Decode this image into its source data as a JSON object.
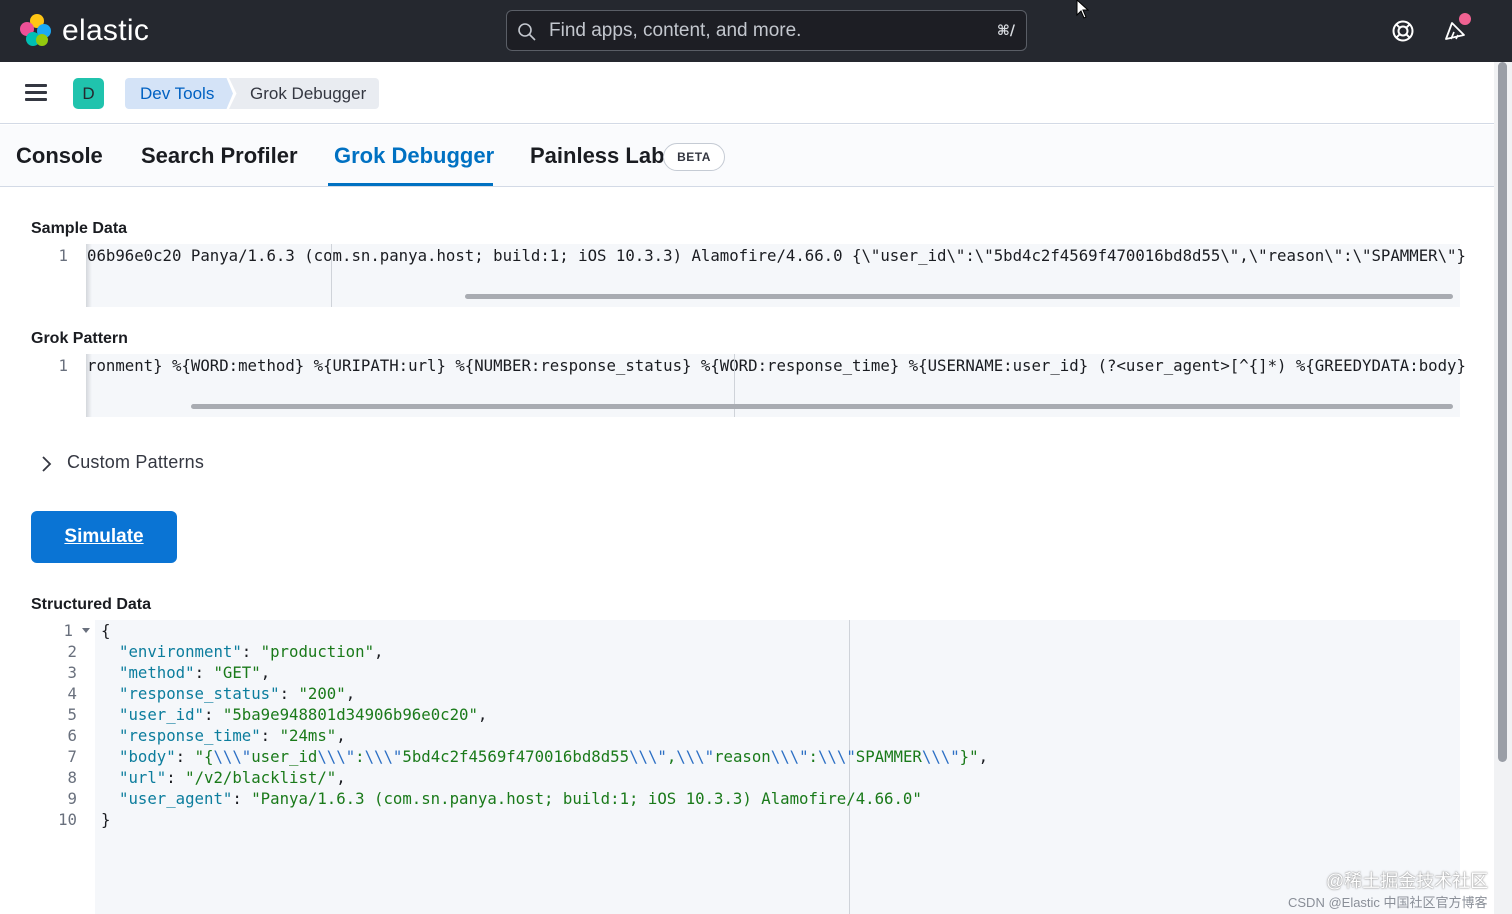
{
  "header": {
    "brand": "elastic",
    "search_placeholder": "Find apps, content, and more.",
    "search_shortcut": "⌘/"
  },
  "breadcrumbs": {
    "space_initial": "D",
    "items": [
      "Dev Tools",
      "Grok Debugger"
    ]
  },
  "tabs": [
    {
      "label": "Console",
      "active": false
    },
    {
      "label": "Search Profiler",
      "active": false
    },
    {
      "label": "Grok Debugger",
      "active": true
    },
    {
      "label": "Painless Lab",
      "active": false,
      "badge": "BETA"
    }
  ],
  "sample_data": {
    "label": "Sample Data",
    "line_number": "1",
    "text": "06b96e0c20 Panya/1.6.3 (com.sn.panya.host; build:1; iOS 10.3.3) Alamofire/4.66.0 {\\\"user_id\\\":\\\"5bd4c2f4569f470016bd8d55\\\",\\\"reason\\\":\\\"SPAMMER\\\"}"
  },
  "grok_pattern": {
    "label": "Grok Pattern",
    "line_number": "1",
    "text": "ronment} %{WORD:method} %{URIPATH:url} %{NUMBER:response_status} %{WORD:response_time} %{USERNAME:user_id} (?<user_agent>[^{]*) %{GREEDYDATA:body}"
  },
  "custom_patterns": {
    "label": "Custom Patterns"
  },
  "simulate_button": "Simulate",
  "structured_data": {
    "label": "Structured Data",
    "line_numbers": [
      "1",
      "2",
      "3",
      "4",
      "5",
      "6",
      "7",
      "8",
      "9",
      "10"
    ],
    "open_brace": "{",
    "close_brace": "}",
    "fields": [
      {
        "key": "\"environment\"",
        "value": "\"production\"",
        "comma": ","
      },
      {
        "key": "\"method\"",
        "value": "\"GET\"",
        "comma": ","
      },
      {
        "key": "\"response_status\"",
        "value": "\"200\"",
        "comma": ","
      },
      {
        "key": "\"user_id\"",
        "value": "\"5ba9e948801d34906b96e0c20\"",
        "comma": ","
      },
      {
        "key": "\"response_time\"",
        "value": "\"24ms\"",
        "comma": ","
      },
      {
        "key": "\"body\"",
        "value": "\"{\\\\\\\"user_id\\\\\\\":\\\\\\\"5bd4c2f4569f470016bd8d55\\\\\\\",\\\\\\\"reason\\\\\\\":\\\\\\\"SPAMMER\\\\\\\"}\"",
        "comma": ","
      },
      {
        "key": "\"url\"",
        "value": "\"/v2/blacklist/\"",
        "comma": ","
      },
      {
        "key": "\"user_agent\"",
        "value": "\"Panya/1.6.3 (com.sn.panya.host; build:1; iOS 10.3.3) Alamofire/4.66.0\"",
        "comma": ""
      }
    ]
  },
  "watermark": {
    "line1": "@稀土掘金技术社区",
    "line2": "CSDN @Elastic 中国社区官方博客"
  },
  "colors": {
    "header_bg": "#25282f",
    "accent": "#0071c2",
    "button": "#0a74d4"
  }
}
